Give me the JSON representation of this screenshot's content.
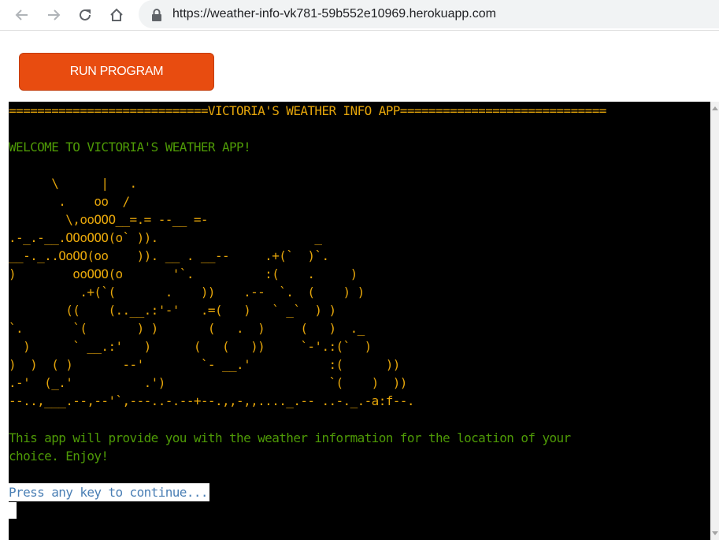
{
  "browser": {
    "url": "https://weather-info-vk781-59b552e10969.herokuapp.com",
    "icons": {
      "back": "arrow-left-icon",
      "forward": "arrow-right-icon",
      "reload": "reload-icon",
      "home": "home-icon",
      "lock": "lock-icon"
    }
  },
  "run_button": {
    "label": "RUN PROGRAM",
    "color": "#e84c10"
  },
  "terminal": {
    "header": "============================VICTORIA'S WEATHER INFO APP=============================",
    "welcome": "WELCOME TO VICTORIA'S WEATHER APP!",
    "ascii_art": "      \\      |   .\n       .    oo  /\n        \\,ooOOO__=.= --__ =-\n.-_.-__.OOoOOO(o` )).                      _\n__-._..OoOO(oo    )). __ . __--     .+(`  )`.\n)        ooOOO(o       '`.          :(    .     )\n          .+(`(       .    ))    .--  `.  (    ) )\n        ((    (..__.:'-'   .=(   )   ` _`  ) )\n`.       `(       ) )       (   .  )     (   )  ._\n  )      ` __.:'   )      (   (   ))     `-'.:(`  )\n)  )  ( )       --'        `- __.'           :(      ))\n.-'  (_.'          .')                       `(    )  ))\n--..,___.--,--'`,---..-.--+--.,,-,,...._.-- ..-._.-a:f--.",
    "intro": "This app will provide you with the weather information for the location of your\nchoice. Enjoy!",
    "prompt": "Press any key to continue...",
    "colors": {
      "background": "#000000",
      "orange": "#e5a50a",
      "green": "#4e9a06"
    }
  }
}
